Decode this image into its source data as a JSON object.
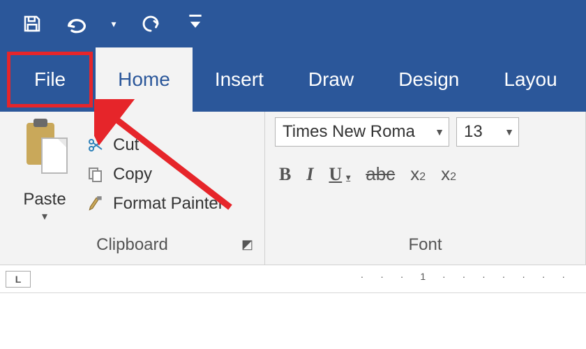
{
  "quick_access": {
    "save": "save-icon",
    "undo": "undo-icon",
    "redo": "redo-icon",
    "customize": "customize-icon"
  },
  "tabs": {
    "file": "File",
    "home": "Home",
    "insert": "Insert",
    "draw": "Draw",
    "design": "Design",
    "layout": "Layou"
  },
  "clipboard": {
    "paste": "Paste",
    "cut": "Cut",
    "copy": "Copy",
    "format_painter": "Format Painter",
    "group_label": "Clipboard"
  },
  "font": {
    "family": "Times New Roma",
    "size": "13",
    "bold": "B",
    "italic": "I",
    "underline": "U",
    "strike": "abc",
    "subscript_base": "x",
    "subscript_sub": "2",
    "superscript_base": "x",
    "superscript_sup": "2",
    "group_label": "Font"
  },
  "ruler": {
    "corner": "L",
    "tick": "1"
  },
  "annotation": {
    "highlight": "File tab highlighted with red box and arrow"
  }
}
